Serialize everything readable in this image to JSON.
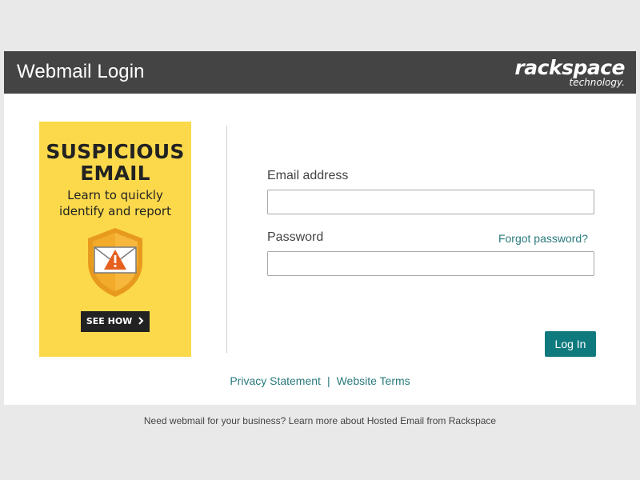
{
  "header": {
    "title": "Webmail Login",
    "logo_main": "rackspace",
    "logo_sub": "technology."
  },
  "promo": {
    "title_line1": "SUSPICIOUS",
    "title_line2": "EMAIL",
    "subtitle_line1": "Learn to quickly",
    "subtitle_line2": "identify and report",
    "button_label": "SEE HOW",
    "button_icon": "chevron-right-icon",
    "illustration_icon": "shield-warning-envelope-icon",
    "background_color": "#fcd94b"
  },
  "form": {
    "email_label": "Email address",
    "email_value": "",
    "password_label": "Password",
    "password_value": "",
    "forgot_label": "Forgot password?",
    "login_label": "Log In"
  },
  "links": {
    "privacy": "Privacy Statement",
    "separator": "|",
    "terms": "Website Terms"
  },
  "footer": {
    "text": "Need webmail for your business? Learn more about Hosted Email from Rackspace"
  },
  "colors": {
    "header_bg": "#444444",
    "accent": "#0f7a7e",
    "link": "#2a7a7c",
    "page_bg": "#e9e9e9"
  }
}
